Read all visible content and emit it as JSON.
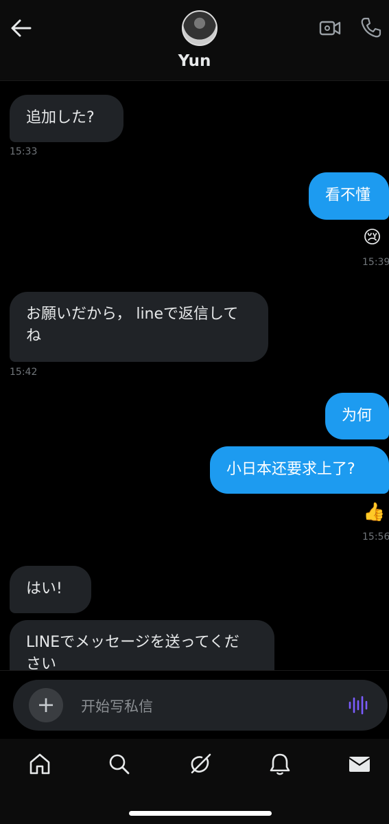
{
  "contact": {
    "name": "Yun"
  },
  "messages": [
    {
      "direction": "in",
      "text": "追加した?",
      "time": "15:33"
    },
    {
      "direction": "out",
      "text": "看不懂",
      "reaction": "😢",
      "time": "15:39"
    },
    {
      "direction": "in",
      "text_line1": "お願いだから， lineで返信して",
      "text_line2": "ね",
      "time": "15:42"
    },
    {
      "direction": "out",
      "text": "为何"
    },
    {
      "direction": "out",
      "text": "小日本还要求上了?",
      "reaction": "👍",
      "time": "15:56"
    },
    {
      "direction": "in",
      "text": "はい!"
    },
    {
      "direction": "in",
      "text_line1": "LINEでメッセージを送ってくだ",
      "text_line2": "さい"
    }
  ],
  "composer": {
    "placeholder": "开始写私信",
    "plus": "+"
  },
  "icons": {
    "header": [
      "back-arrow-icon",
      "video-call-icon",
      "phone-call-icon"
    ],
    "composer": [
      "plus-icon",
      "voice-waveform-icon"
    ],
    "nav": [
      "home-icon",
      "search-icon",
      "grok-icon",
      "notifications-icon",
      "messages-icon"
    ]
  },
  "colors": {
    "outgoing_bubble": "#1d9bf0",
    "incoming_bubble": "#202327",
    "voice_accent": "#7b5cff"
  }
}
